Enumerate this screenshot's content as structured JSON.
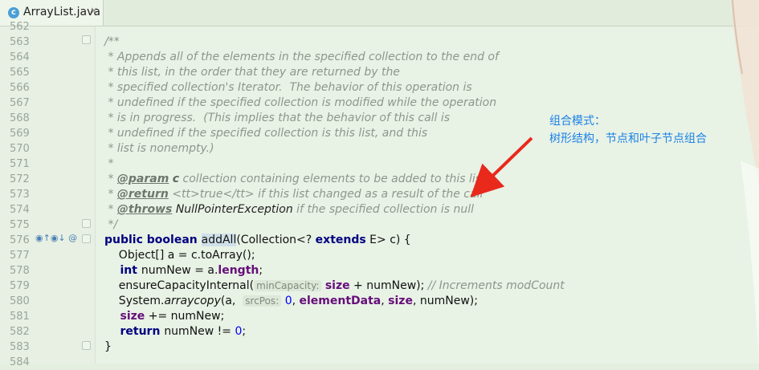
{
  "tab": {
    "filename": "ArrayList.java",
    "close_symbol": "×",
    "icon_letter": "c"
  },
  "lines": [
    {
      "n": "562",
      "text": ""
    },
    {
      "n": "563",
      "text": "/**"
    },
    {
      "n": "564",
      "text": " * Appends all of the elements in the specified collection to the end of"
    },
    {
      "n": "565",
      "text": " * this list, in the order that they are returned by the"
    },
    {
      "n": "566",
      "text": " * specified collection's Iterator.  The behavior of this operation is"
    },
    {
      "n": "567",
      "text": " * undefined if the specified collection is modified while the operation"
    },
    {
      "n": "568",
      "text": " * is in progress.  (This implies that the behavior of this call is"
    },
    {
      "n": "569",
      "text": " * undefined if the specified collection is this list, and this"
    },
    {
      "n": "570",
      "text": " * list is nonempty.)"
    },
    {
      "n": "571",
      "text": " *"
    },
    {
      "n": "572",
      "text": ""
    },
    {
      "n": "573",
      "text": ""
    },
    {
      "n": "574",
      "text": ""
    },
    {
      "n": "575",
      "text": " */"
    },
    {
      "n": "576",
      "text": ""
    },
    {
      "n": "577",
      "text": ""
    },
    {
      "n": "578",
      "text": ""
    },
    {
      "n": "579",
      "text": ""
    },
    {
      "n": "580",
      "text": ""
    },
    {
      "n": "581",
      "text": ""
    },
    {
      "n": "582",
      "text": ""
    },
    {
      "n": "583",
      "text": "}"
    },
    {
      "n": "584",
      "text": ""
    }
  ],
  "tokens": {
    "l572": {
      "star": " * ",
      "tag": "@param",
      "param": "c",
      "rest": " collection containing elements to be added to this list"
    },
    "l573": {
      "star": " * ",
      "tag": "@return",
      "rest": " <tt>true</tt> if this list changed as a result of the call"
    },
    "l574": {
      "star": " * ",
      "tag": "@throws",
      "exc": "NullPointerException",
      "rest": " if the specified collection is null"
    },
    "l576": {
      "kw": "public boolean ",
      "name": "addAll",
      "rest1": "(Collection<? ",
      "ext": "extends",
      "rest2": " E> c) {"
    },
    "l577": {
      "text": "    Object[] a = c.toArray();"
    },
    "l578": {
      "kw": "    int ",
      "mid": "numNew = a.",
      "field": "length",
      "end": ";"
    },
    "l579": {
      "call": "    ensureCapacityInternal(",
      "hint": "minCapacity:",
      "field": "size",
      "rest": " + numNew);",
      "cmt": " // Increments modCount"
    },
    "l580": {
      "pre": "    System.",
      "static": "arraycopy",
      "a": "(a,  ",
      "hint": "srcPos:",
      "zero": "0",
      "c1": ", ",
      "f1": "elementData",
      "c2": ", ",
      "f2": "size",
      "end": ", numNew);"
    },
    "l581": {
      "field": "    size",
      "rest": " += numNew;"
    },
    "l582": {
      "kw": "    return ",
      "rest": "numNew != ",
      "zero": "0",
      "end": ";"
    }
  },
  "gutter_icons": "◉↑◉↓ @",
  "annotation": {
    "line1": "组合模式：",
    "line2": "树形结构，节点和叶子节点组合"
  },
  "colors": {
    "annotation": "#1c82e6",
    "arrow": "#e8291c",
    "background": "#e8f2e5"
  }
}
